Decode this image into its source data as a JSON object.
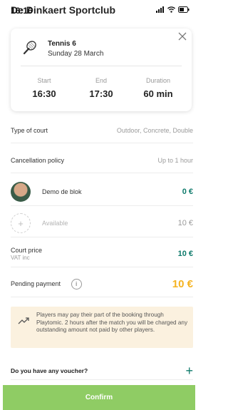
{
  "status": {
    "time": "16:16"
  },
  "app": {
    "title": "De Dinkaert Sportclub"
  },
  "booking": {
    "sport_icon": "tennis-racket-icon",
    "title": "Tennis 6",
    "date": "Sunday 28 March",
    "start_label": "Start",
    "start_value": "16:30",
    "end_label": "End",
    "end_value": "17:30",
    "duration_label": "Duration",
    "duration_value": "60 min"
  },
  "details": {
    "court_type_label": "Type of court",
    "court_type_value": "Outdoor, Concrete, Double",
    "cancellation_label": "Cancellation policy",
    "cancellation_value": "Up to 1 hour"
  },
  "players": [
    {
      "name": "Demo de blok",
      "amount": "0 €"
    },
    {
      "name": "Available",
      "amount": "10 €"
    }
  ],
  "court_price": {
    "label": "Court price",
    "sublabel": "VAT inc",
    "amount": "10 €"
  },
  "pending": {
    "label": "Pending payment",
    "amount": "10 €"
  },
  "notice": {
    "text": "Players may pay their part of the booking through Playtomic. 2 hours after the match you will be charged any outstanding amount not paid by other players."
  },
  "voucher": {
    "label": "Do you have any voucher?"
  },
  "confirm": {
    "label": "Confirm"
  },
  "colors": {
    "green": "#0e7a6b",
    "orange": "#f5b321",
    "confirm_bg": "#8fcc64",
    "notice_bg": "#fbf1df"
  }
}
